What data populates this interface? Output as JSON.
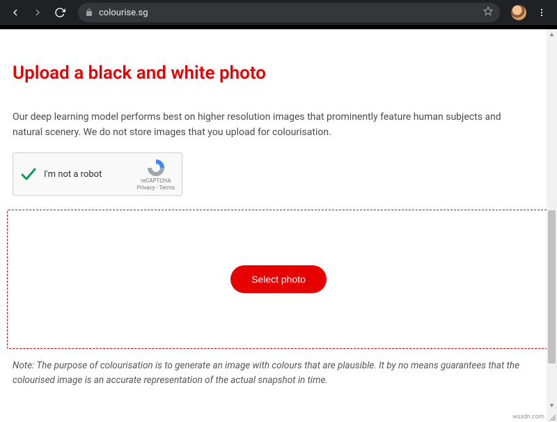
{
  "browser": {
    "url": "colourise.sg"
  },
  "page": {
    "title": "Upload a black and white photo",
    "description": "Our deep learning model performs best on higher resolution images that prominently feature human subjects and natural scenery. We do not store images that you upload for colourisation.",
    "recaptcha": {
      "label": "I'm not a robot",
      "brand": "reCAPTCHA",
      "legal": "Privacy - Terms"
    },
    "select_button": "Select photo",
    "note": "Note: The purpose of colourisation is to generate an image with colours that are plausible. It by no means guarantees that the colourised image is an accurate representation of the actual snapshot in time."
  },
  "watermark": "wsxdn.com"
}
